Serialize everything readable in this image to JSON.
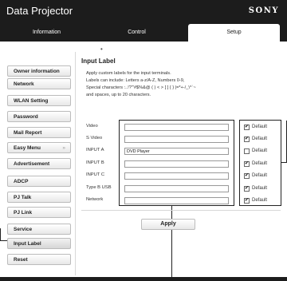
{
  "header": {
    "title": "Data Projector",
    "brand": "SONY",
    "tabs": [
      "Information",
      "Control",
      "Setup"
    ]
  },
  "sidebar": {
    "items": [
      {
        "label": "Owner information"
      },
      {
        "label": "Network"
      },
      {
        "label": "WLAN Setting"
      },
      {
        "label": "Password"
      },
      {
        "label": "Mail Report"
      },
      {
        "label": "Easy Menu",
        "arrow": "»"
      },
      {
        "label": "Advertisement"
      },
      {
        "label": "ADCP"
      },
      {
        "label": "PJ Talk"
      },
      {
        "label": "PJ Link"
      },
      {
        "label": "Service"
      },
      {
        "label": "Input Label",
        "active": true
      },
      {
        "label": "Reset"
      }
    ]
  },
  "main": {
    "title": "Input Label",
    "description": [
      "Apply custom labels for the input terminals.",
      "Labels can include: Letters a-z/A-Z, Numbers 0-9,",
      "Special characters :..!?'\"#$%&@ ( ) < > [ ] { } |=*+-/_\\^`~",
      "and spaces, up to 20 characters."
    ],
    "rows": [
      {
        "label": "Video",
        "value": "",
        "default_checked": true
      },
      {
        "label": "S Video",
        "value": "",
        "default_checked": true
      },
      {
        "label": "INPUT A",
        "value": "DVD Player",
        "default_checked": false
      },
      {
        "label": "INPUT B",
        "value": "",
        "default_checked": true
      },
      {
        "label": "INPUT C",
        "value": "",
        "default_checked": true
      },
      {
        "label": "Type B USB",
        "value": "",
        "default_checked": true
      },
      {
        "label": "Network",
        "value": "",
        "default_checked": true
      }
    ],
    "default_label": "Default",
    "apply_label": "Apply"
  },
  "colors": {
    "header_bg": "#1c1c1c",
    "button_border": "#bcbcbc"
  }
}
